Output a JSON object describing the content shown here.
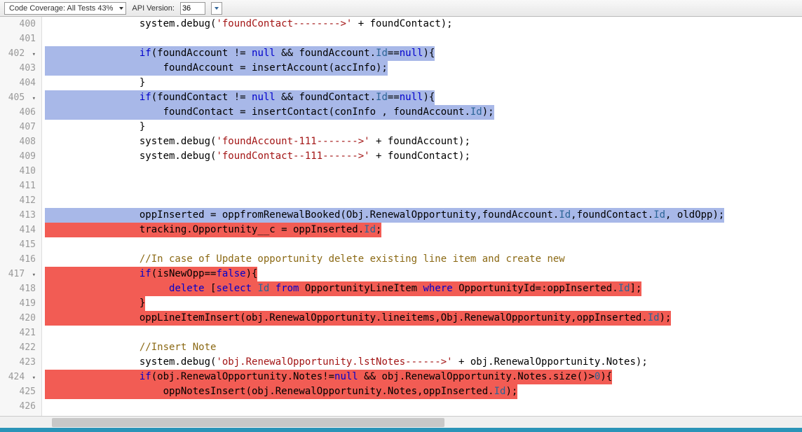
{
  "toolbar": {
    "coverage_label": "Code Coverage: All Tests 43%",
    "api_label": "API Version:",
    "api_value": "36"
  },
  "gutter": {
    "lines": [
      {
        "n": "400",
        "fold": ""
      },
      {
        "n": "401",
        "fold": ""
      },
      {
        "n": "402",
        "fold": "▾"
      },
      {
        "n": "403",
        "fold": ""
      },
      {
        "n": "404",
        "fold": ""
      },
      {
        "n": "405",
        "fold": "▾"
      },
      {
        "n": "406",
        "fold": ""
      },
      {
        "n": "407",
        "fold": ""
      },
      {
        "n": "408",
        "fold": ""
      },
      {
        "n": "409",
        "fold": ""
      },
      {
        "n": "410",
        "fold": ""
      },
      {
        "n": "411",
        "fold": ""
      },
      {
        "n": "412",
        "fold": ""
      },
      {
        "n": "413",
        "fold": ""
      },
      {
        "n": "414",
        "fold": ""
      },
      {
        "n": "415",
        "fold": ""
      },
      {
        "n": "416",
        "fold": ""
      },
      {
        "n": "417",
        "fold": "▾"
      },
      {
        "n": "418",
        "fold": ""
      },
      {
        "n": "419",
        "fold": ""
      },
      {
        "n": "420",
        "fold": ""
      },
      {
        "n": "421",
        "fold": ""
      },
      {
        "n": "422",
        "fold": ""
      },
      {
        "n": "423",
        "fold": ""
      },
      {
        "n": "424",
        "fold": "▾"
      },
      {
        "n": "425",
        "fold": ""
      },
      {
        "n": "426",
        "fold": ""
      }
    ]
  },
  "code": {
    "l400_a": "                system.debug(",
    "l400_b": "'foundContact-------->'",
    "l400_c": " + foundContact);",
    "l401": " ",
    "l402_a": "                ",
    "l402_b": "if",
    "l402_c": "(foundAccount != ",
    "l402_d": "null",
    "l402_e": " && foundAccount.",
    "l402_f": "Id",
    "l402_g": "==",
    "l402_h": "null",
    "l402_i": "){",
    "l403_a": "                    foundAccount = insertAccount(accInfo);",
    "l404_a": "                }",
    "l405_a": "                ",
    "l405_b": "if",
    "l405_c": "(foundContact != ",
    "l405_d": "null",
    "l405_e": " && foundContact.",
    "l405_f": "Id",
    "l405_g": "==",
    "l405_h": "null",
    "l405_i": "){",
    "l406_a": "                    foundContact = insertContact(conInfo , foundAccount.",
    "l406_b": "Id",
    "l406_c": ");",
    "l407_a": "                }",
    "l408_a": "                system.debug(",
    "l408_b": "'foundAccount-111------->'",
    "l408_c": " + foundAccount);",
    "l409_a": "                system.debug(",
    "l409_b": "'foundContact--111------>'",
    "l409_c": " + foundContact);",
    "l410": " ",
    "l411": " ",
    "l412": " ",
    "l413_a": "                oppInserted = oppfromRenewalBooked(Obj.RenewalOpportunity,foundAccount.",
    "l413_b": "Id",
    "l413_c": ",foundContact.",
    "l413_d": "Id",
    "l413_e": ", oldOpp);",
    "l414_a": "                tracking.Opportunity__c = oppInserted.",
    "l414_b": "Id",
    "l414_c": ";",
    "l415": " ",
    "l416_a": "                ",
    "l416_b": "//In case of Update opportunity delete existing line item and create new",
    "l417_a": "                ",
    "l417_b": "if",
    "l417_c": "(isNewOpp==",
    "l417_d": "false",
    "l417_e": "){",
    "l418_a": "                     ",
    "l418_b": "delete",
    "l418_c": " [",
    "l418_d": "select",
    "l418_e": " ",
    "l418_f": "Id",
    "l418_g": " ",
    "l418_h": "from",
    "l418_i": " OpportunityLineItem ",
    "l418_j": "where",
    "l418_k": " OpportunityId=:oppInserted.",
    "l418_l": "Id",
    "l418_m": "];",
    "l419_a": "                }",
    "l420_a": "                oppLineItemInsert(obj.RenewalOpportunity.lineitems,Obj.RenewalOpportunity,oppInserted.",
    "l420_b": "Id",
    "l420_c": ");",
    "l421": " ",
    "l422_a": "                ",
    "l422_b": "//Insert Note",
    "l423_a": "                system.debug(",
    "l423_b": "'obj.RenewalOpportunity.lstNotes------>'",
    "l423_c": " + obj.RenewalOpportunity.Notes);",
    "l424_a": "                ",
    "l424_b": "if",
    "l424_c": "(obj.RenewalOpportunity.Notes!=",
    "l424_d": "null",
    "l424_e": " && obj.RenewalOpportunity.Notes.size()>",
    "l424_f": "0",
    "l424_g": "){",
    "l425_a": "                    oppNotesInsert(obj.RenewalOpportunity.Notes,oppInserted.",
    "l425_b": "Id",
    "l425_c": ");",
    "l426": " "
  }
}
